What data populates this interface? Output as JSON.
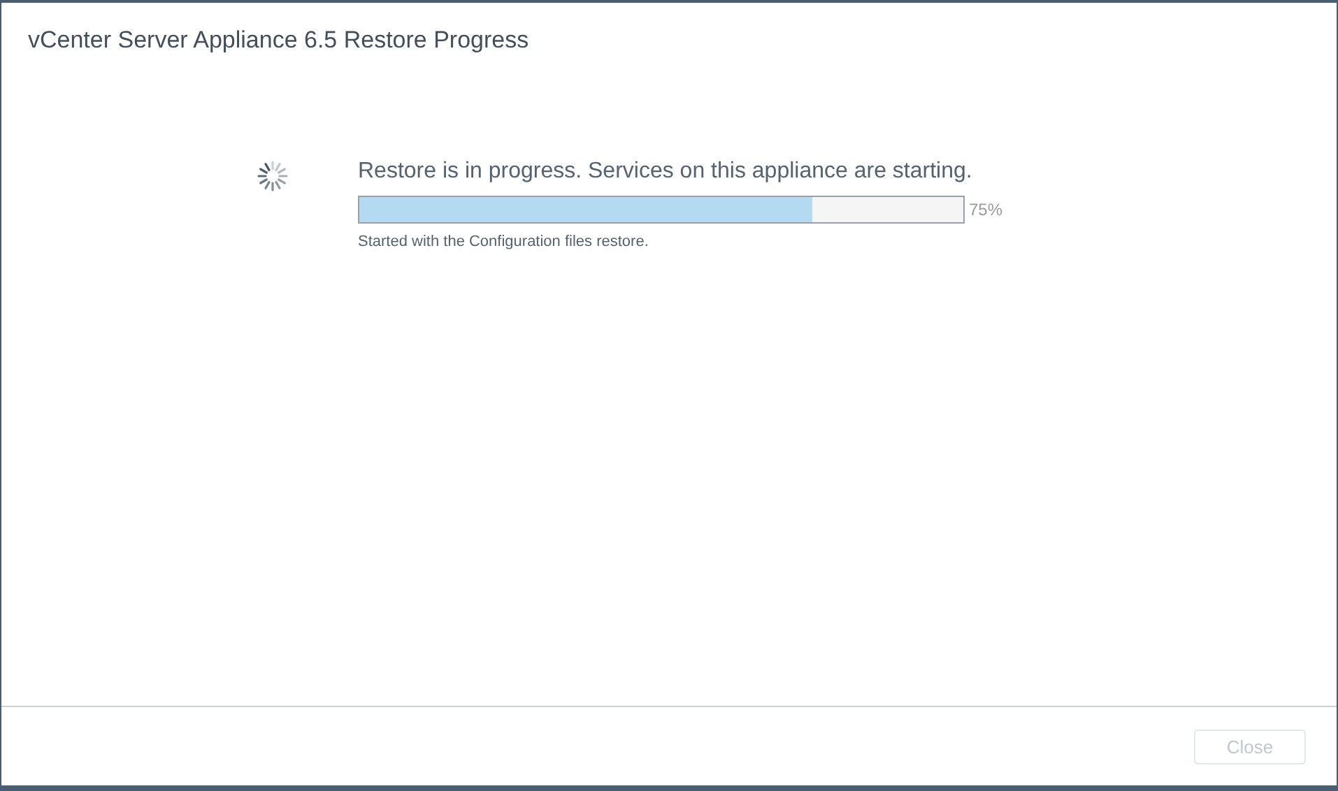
{
  "window": {
    "title": "vCenter Server Appliance 6.5 Restore Progress"
  },
  "progress": {
    "message": "Restore is in progress. Services on this appliance are starting.",
    "level": 0.75,
    "reading": "75%",
    "detail": "Started with the Configuration files restore."
  },
  "buttons": [
    {
      "label": "Close",
      "disabled": true
    }
  ]
}
